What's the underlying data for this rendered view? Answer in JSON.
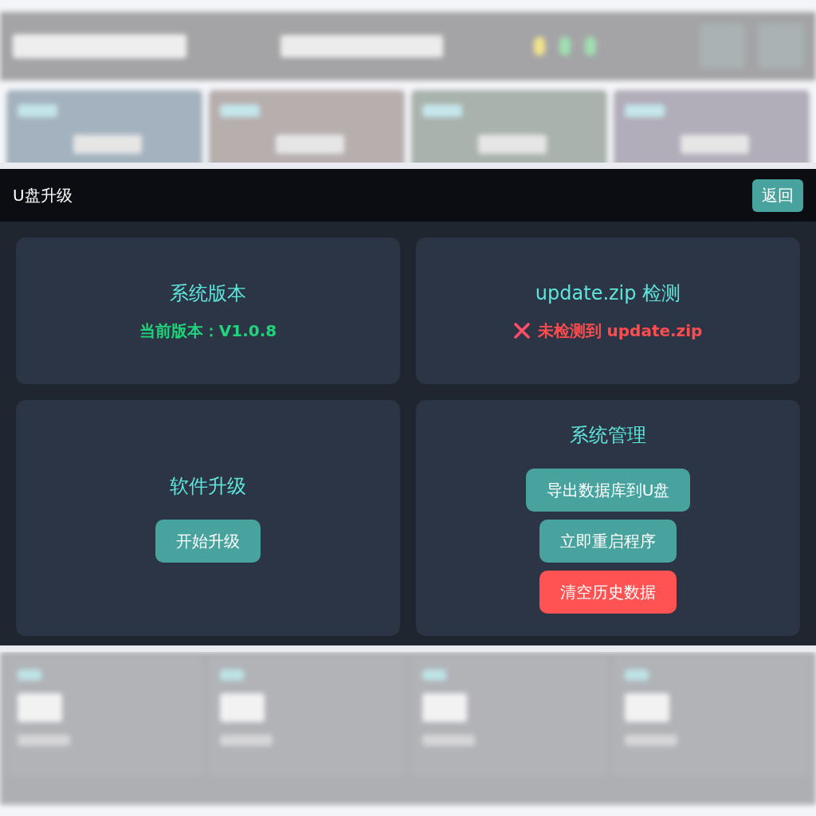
{
  "dialog": {
    "title": "U盘升级",
    "back_button": "返回"
  },
  "cards": [
    {
      "kind": "info",
      "title": "系统版本",
      "status": {
        "kind": "ok",
        "text": "当前版本：V1.0.8"
      }
    },
    {
      "kind": "info",
      "title": "update.zip 检测",
      "status": {
        "kind": "error",
        "text": "未检测到 update.zip"
      }
    },
    {
      "kind": "actions",
      "title": "软件升级",
      "buttons": [
        {
          "kind": "primary",
          "label": "开始升级"
        }
      ]
    },
    {
      "kind": "actions",
      "title": "系统管理",
      "buttons": [
        {
          "kind": "primary",
          "label": "导出数据库到U盘"
        },
        {
          "kind": "primary",
          "label": "立即重启程序"
        },
        {
          "kind": "danger",
          "label": "清空历史数据"
        }
      ]
    }
  ]
}
